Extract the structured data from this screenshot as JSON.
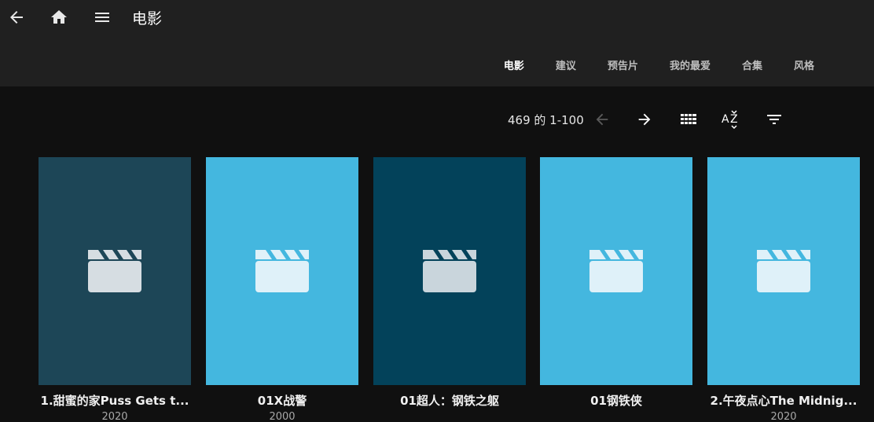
{
  "header": {
    "title": "电影",
    "back_icon": "arrow-left-icon",
    "home_icon": "home-icon",
    "menu_icon": "hamburger-menu-icon"
  },
  "tabs": [
    {
      "label": "电影",
      "active": true
    },
    {
      "label": "建议",
      "active": false
    },
    {
      "label": "预告片",
      "active": false
    },
    {
      "label": "我的最爱",
      "active": false
    },
    {
      "label": "合集",
      "active": false
    },
    {
      "label": "风格",
      "active": false
    }
  ],
  "toolbar": {
    "paging_text": "469 的 1-100",
    "prev_icon": "arrow-left-icon",
    "next_icon": "arrow-right-icon",
    "view_icon": "grid-view-icon",
    "sort_icon": "sort-az-icon",
    "filter_icon": "filter-icon"
  },
  "movies": [
    {
      "title": "1.甜蜜的家Puss Gets t...",
      "year": "2020",
      "color": "#1d4657"
    },
    {
      "title": "01X战警",
      "year": "2000",
      "color": "#44b7df"
    },
    {
      "title": "01超人：钢铁之躯",
      "year": "",
      "color": "#03425a"
    },
    {
      "title": "01钢铁侠",
      "year": "",
      "color": "#44b7df"
    },
    {
      "title": "2.午夜点心The Midnig...",
      "year": "2020",
      "color": "#44b7df"
    }
  ],
  "colors": {
    "header_bg": "#202020",
    "page_bg": "#101010",
    "accent": "#44b7df"
  }
}
